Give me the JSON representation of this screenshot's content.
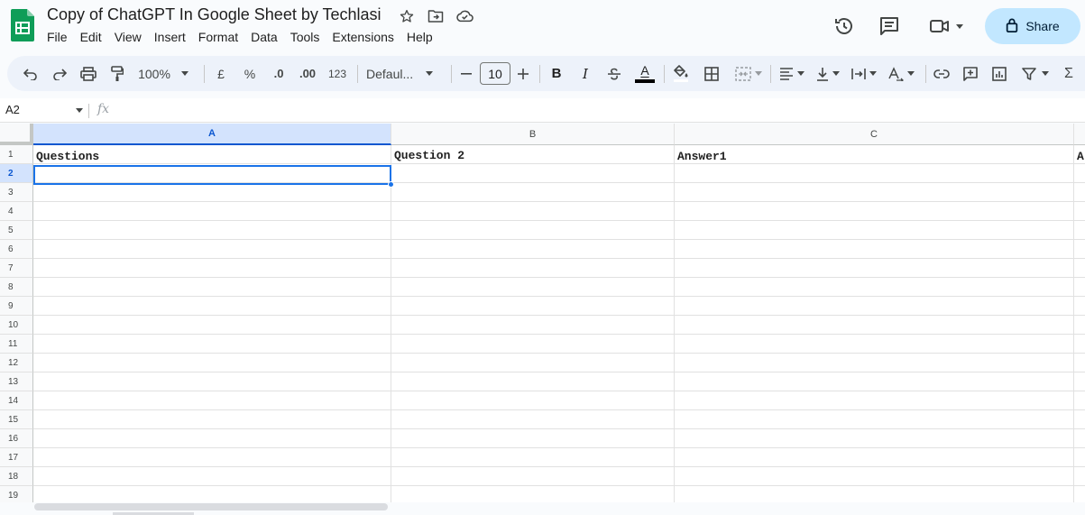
{
  "title": "Copy of ChatGPT In Google Sheet by Techlasi",
  "menu": [
    "File",
    "Edit",
    "View",
    "Insert",
    "Format",
    "Data",
    "Tools",
    "Extensions",
    "Help"
  ],
  "share_label": "Share",
  "toolbar": {
    "zoom": "100%",
    "currency": "£",
    "percent": "%",
    "dec_decrease": ".0",
    "dec_increase": ".00",
    "number_format": "123",
    "font": "Defaul...",
    "font_size": "10",
    "bold": "B",
    "italic": "I",
    "text_color": "A",
    "sum": "Σ"
  },
  "name_box": "A2",
  "fx_label": "fx",
  "columns": [
    "A",
    "B",
    "C"
  ],
  "rows": [
    "1",
    "2",
    "3",
    "4",
    "5",
    "6",
    "7",
    "8",
    "9",
    "10",
    "11",
    "12",
    "13",
    "14",
    "15",
    "16",
    "17",
    "18",
    "19"
  ],
  "cells": {
    "A1": "Questions",
    "B1": "Question 2",
    "C1": "Answer1",
    "D1": "A"
  },
  "selected_cell": "A2",
  "colors": {
    "accent": "#1a73e8",
    "share_bg": "#c2e7ff",
    "toolbar_bg": "#edf2fa",
    "sheets_green": "#0f9d58"
  }
}
